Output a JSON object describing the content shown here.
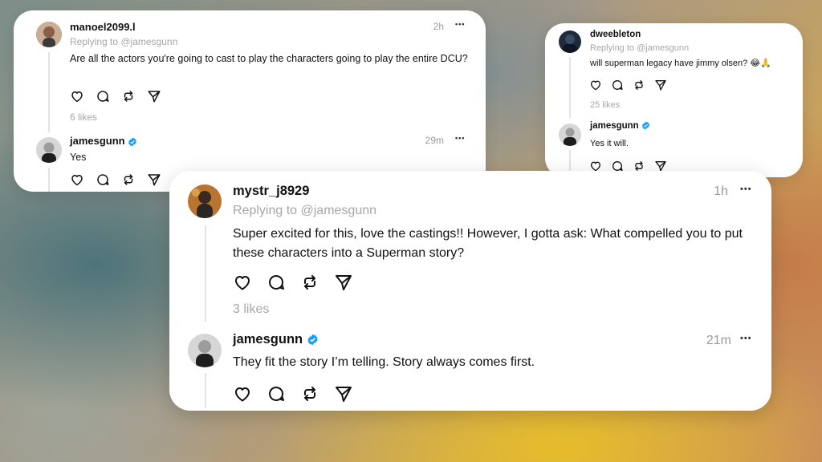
{
  "colors": {
    "verified": "#1d9bf0",
    "muted": "#a7a7a7",
    "text": "#111111"
  },
  "cards": [
    {
      "post": {
        "username": "manoel2099.l",
        "replying": "Replying to @jamesgunn",
        "text": "Are all the actors you're going to cast to play the characters going to play the entire DCU?",
        "time": "2h",
        "likes": "6 likes",
        "avatar_icon": "user-avatar"
      },
      "reply": {
        "username": "jamesgunn",
        "text": "Yes",
        "time": "29m",
        "verified": true
      }
    },
    {
      "post": {
        "username": "dweebleton",
        "replying": "Replying to @jamesgunn",
        "text": "will superman legacy have jimmy olsen? 😂🙏",
        "likes": "25 likes",
        "avatar_icon": "user-avatar"
      },
      "reply": {
        "username": "jamesgunn",
        "text": "Yes it will.",
        "verified": true
      }
    },
    {
      "post": {
        "username": "mystr_j8929",
        "replying": "Replying to @jamesgunn",
        "text": "Super excited for this, love the castings!! However, I gotta ask: What compelled you to put these characters into a Superman story?",
        "time": "1h",
        "likes": "3 likes",
        "avatar_icon": "user-avatar"
      },
      "reply": {
        "username": "jamesgunn",
        "text": "They fit the story I’m telling. Story always comes first.",
        "time": "21m",
        "verified": true
      }
    }
  ],
  "more_label": "•••",
  "action_icons": [
    "heart-icon",
    "comment-icon",
    "repost-icon",
    "share-icon"
  ]
}
